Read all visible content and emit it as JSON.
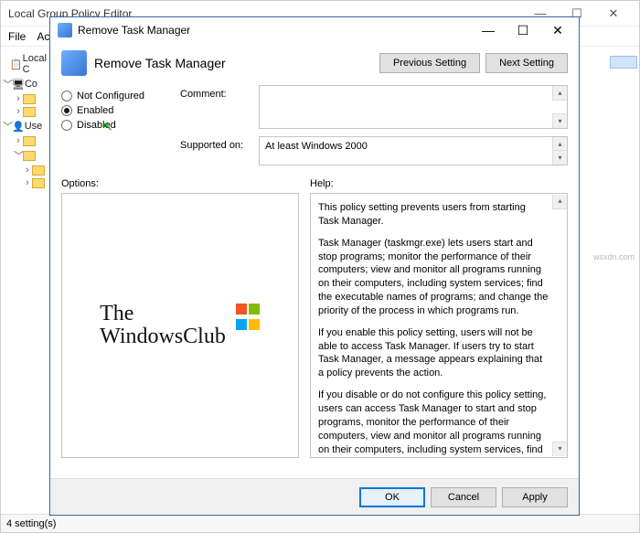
{
  "main_window": {
    "title": "Local Group Policy Editor",
    "menu": {
      "file": "File",
      "action": "Act"
    }
  },
  "tree": {
    "root": "Local C",
    "node1": "Co",
    "node2": "Use"
  },
  "status_bar": {
    "text": "4 setting(s)"
  },
  "dialog": {
    "title": "Remove Task Manager",
    "heading": "Remove Task Manager",
    "nav": {
      "prev": "Previous Setting",
      "next": "Next Setting"
    },
    "radios": {
      "not_configured": "Not Configured",
      "enabled": "Enabled",
      "disabled": "Disabled",
      "selected": "enabled"
    },
    "comment_label": "Comment:",
    "comment_value": "",
    "supported_label": "Supported on:",
    "supported_value": "At least Windows 2000",
    "options_label": "Options:",
    "help_label": "Help:",
    "help_text": {
      "p1": "This policy setting prevents users from starting Task Manager.",
      "p2": "Task Manager (taskmgr.exe) lets users start and stop programs; monitor the performance of their computers; view and monitor all programs running on their computers, including system services; find the executable names of programs; and change the priority of the process in which programs run.",
      "p3": "If you enable this policy setting, users will not be able to access Task Manager. If users try to start Task Manager, a message appears explaining that a policy prevents the action.",
      "p4": "If you disable or do not configure this policy setting, users can access Task Manager to  start and stop programs, monitor the performance of their computers, view and monitor all programs running on their computers, including system services, find the executable names of programs, and change the priority of the process in which programs run."
    },
    "logo": {
      "line1": "The",
      "line2": "WindowsClub"
    },
    "buttons": {
      "ok": "OK",
      "cancel": "Cancel",
      "apply": "Apply"
    }
  },
  "watermark": "wsxdn.com"
}
